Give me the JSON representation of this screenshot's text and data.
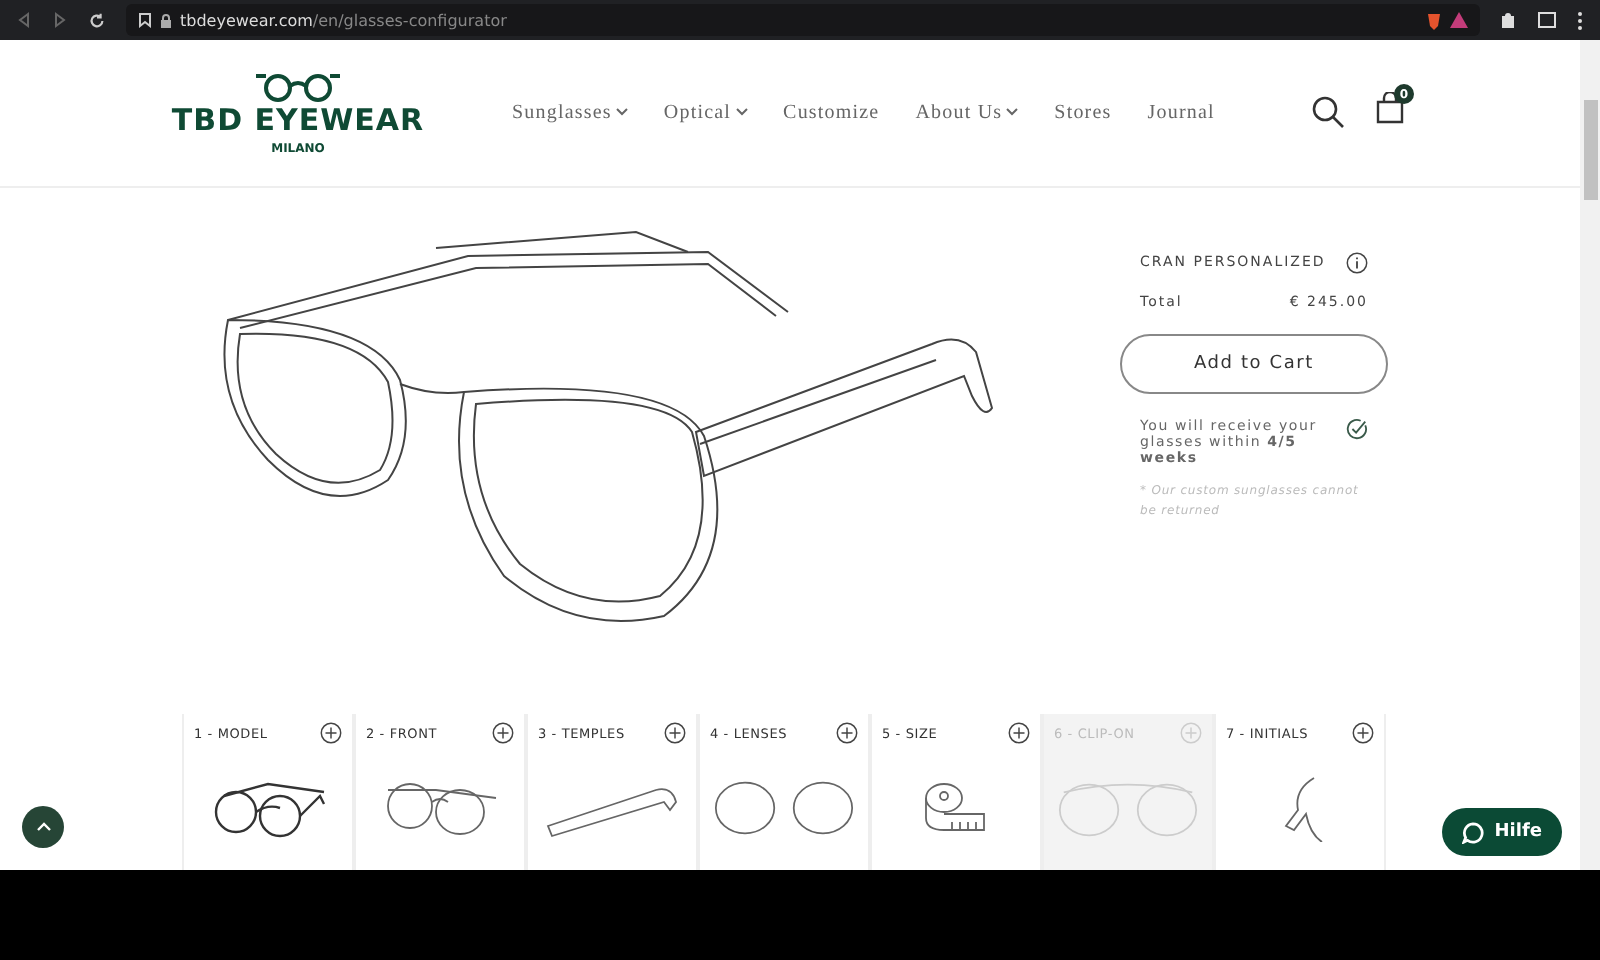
{
  "browser": {
    "url_host": "tbdeyewear.com",
    "url_path": "/en/glasses-configurator"
  },
  "header": {
    "logo": {
      "name": "TBD EYEWEAR",
      "city": "MILANO"
    },
    "nav": [
      {
        "label": "Sunglasses",
        "dropdown": true
      },
      {
        "label": "Optical",
        "dropdown": true
      },
      {
        "label": "Customize",
        "dropdown": false
      },
      {
        "label": "About Us",
        "dropdown": true
      },
      {
        "label": "Stores",
        "dropdown": false
      },
      {
        "label": "Journal",
        "dropdown": false
      }
    ],
    "cart_count": "0"
  },
  "summary": {
    "title": "CRAN PERSONALIZED",
    "total_label": "Total",
    "total_value": "€ 245.00",
    "add_button": "Add to Cart",
    "delivery": "You will receive your glasses within **4/5 weeks**",
    "note": "* Our custom sunglasses cannot be returned"
  },
  "steps": [
    {
      "kind": "model",
      "label": "1 - MODEL",
      "disabled": false
    },
    {
      "kind": "front",
      "label": "2 - FRONT",
      "disabled": false
    },
    {
      "kind": "temples",
      "label": "3 - TEMPLES",
      "disabled": false
    },
    {
      "kind": "lenses",
      "label": "4 - LENSES",
      "disabled": false
    },
    {
      "kind": "size",
      "label": "5 - SIZE",
      "disabled": false
    },
    {
      "kind": "clipon",
      "label": "6 - CLIP-ON",
      "disabled": true
    },
    {
      "kind": "initials",
      "label": "7 - INITIALS",
      "disabled": false
    }
  ],
  "help_button": "Hilfe"
}
